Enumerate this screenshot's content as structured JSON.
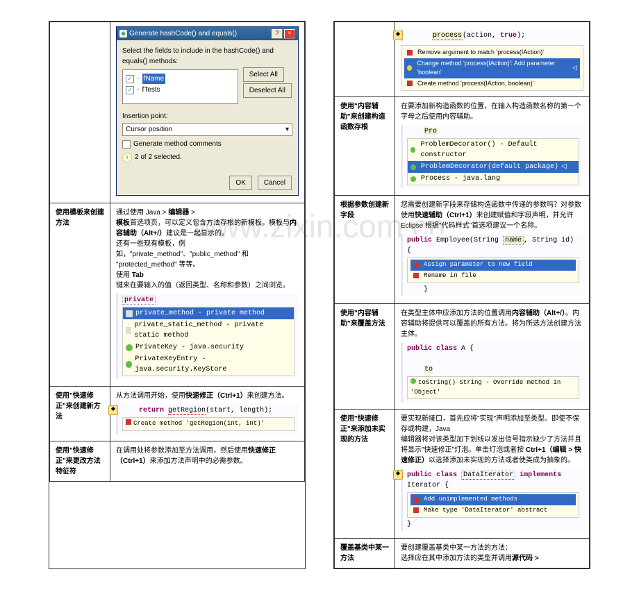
{
  "dialog": {
    "title": "Generate hashCode() and equals()",
    "instruction": "Select the fields to include in the hashCode() and equals() methods:",
    "fields": [
      "fName",
      "fTests"
    ],
    "btn_select_all": "Select All",
    "btn_deselect_all": "Deselect All",
    "insertion_label": "Insertion point:",
    "insertion_value": "Cursor position",
    "generate_comments": "Generate method comments",
    "status": "2 of 2 selected.",
    "ok": "OK",
    "cancel": "Cancel"
  },
  "left": {
    "row1": {
      "label": "使用模板来创建方法",
      "body1": "通过使用 Java > ",
      "bold1": "编辑器",
      "body1b": " > ",
      "body2a": "模板",
      "body2b": "首选项页，可以定义包含方法存根的新模板。模板与",
      "bold2": "内容辅助（Alt+/）",
      "body2c": "建议是一起显示的。",
      "body3": "还有一些现有模板，例如，\"private_method\"、\"public_method\" 和 \"protected_method\" 等等。",
      "body4": "使用 ",
      "bold3": "Tab",
      "body5": "键来在要输入的值（返回类型、名称和参数）之间浏览。",
      "code_kw": "private",
      "menu_items": [
        {
          "text": "private_method - private method",
          "sel": true
        },
        {
          "text": "private_static_method - private static method"
        },
        {
          "text": "PrivateKey - java.security"
        },
        {
          "text": "PrivateKeyEntry - java.security.KeyStore"
        }
      ]
    },
    "row2": {
      "label": "使用\"快速修正\"来创建新方法",
      "body": "从方法调用开始，使用",
      "bold": "快速修正（Ctrl+1）",
      "body2": "来创建方法。",
      "code": "return getRegion(start, length);",
      "tip": "Create method 'getRegion(int, int)'"
    },
    "row3": {
      "label": "使用\"快速修正\"来更改方法特征符",
      "body": "在调用处将参数添加至方法调用，然后使用",
      "bold": "快速修正（Ctrl+1）",
      "body2": "来添加方法声明中的必需参数。"
    }
  },
  "right": {
    "row0_code": "process(action, true);",
    "row0_tips": [
      {
        "icon": "r",
        "text": "Remove argument to match 'process(IAction)'"
      },
      {
        "icon": "y",
        "text": "Change method 'process(IAction)': Add parameter 'boolean'",
        "sel": true
      },
      {
        "icon": "r",
        "text": "Create method 'process(IAction, boolean)'"
      }
    ],
    "row1": {
      "label": "使用\"内容辅助\"来创建构造函数存根",
      "body": "在要添加新构造函数的位置，在输入构造函数名称的第一个字母之后使用内容辅助。",
      "code_prefix": "Pro",
      "menu": [
        {
          "text": "ProblemDecorator() - Default constructor"
        },
        {
          "text": "ProblemDecorator(default package)",
          "sel": true
        },
        {
          "text": "Process - java.lang"
        }
      ]
    },
    "row2": {
      "label": "根据参数创建新字段",
      "body": "您需要创建新字段来存储构造函数中传递的参数吗？对参数使用",
      "bold": "快速辅助（Ctrl+1）",
      "body2": "来创建赋值和字段声明，并允许 Eclipse 根据\"代码样式\"首选项建议一个名称。",
      "code": "public Employee(String name, String id) {",
      "tip1": "Assign parameter to new field",
      "tip2": "Rename in file"
    },
    "row3": {
      "label": "使用\"内容辅助\"来覆盖方法",
      "body": "在类型主体中应添加方法的位置调用",
      "bold": "内容辅助（Alt+/）",
      "body2": "。内容辅助将提供可以覆盖的所有方法。将为所选方法创建方法主体。",
      "code1": "public class A {",
      "code2": "to",
      "tip": "toString()  String - Override method in 'Object'"
    },
    "row4": {
      "label": "使用\"快速修正\"来添加未实现的方法",
      "body1": "要实现新接口，首先应将\"实现\"声明添加至类型。即使不保存或构建，Java",
      "body2": "编辑器将对该类型加下划线以发出信号指示缺少了方法并且将显示\"快速修正\"灯泡。单击灯泡或者按 ",
      "bold": "Ctrl+1（编辑 > 快速修正）",
      "body3": "以选择添加未实现的方法或者使类成为抽象的。",
      "code": "public class DataIterator implements Iterator {",
      "tip1": "Add unimplemented methods",
      "tip2": "Make type 'DataIterator' abstract"
    },
    "row5": {
      "label": "覆盖基类中某一方法",
      "body": "要创建覆盖基类中某一方法的方法：",
      "body2": "选择应在其中添加方法的类型并调用",
      "bold": "源代码 >"
    }
  }
}
